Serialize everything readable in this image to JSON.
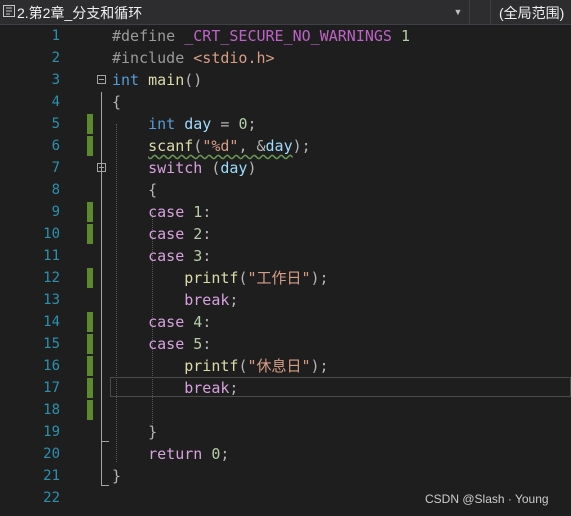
{
  "topbar": {
    "file_label": "2.第2章_分支和循环",
    "scope_label": "(全局范围)"
  },
  "line_numbers": [
    "1",
    "2",
    "3",
    "4",
    "5",
    "6",
    "7",
    "8",
    "9",
    "10",
    "11",
    "12",
    "13",
    "14",
    "15",
    "16",
    "17",
    "18",
    "19",
    "20",
    "21",
    "22"
  ],
  "code": {
    "l1_directive": "#define",
    "l1_macro": "_CRT_SECURE_NO_WARNINGS",
    "l1_value": "1",
    "l2_directive": "#include",
    "l2_header": "<stdio.h>",
    "l3_type": "int",
    "l3_name": "main",
    "l3_parens": "()",
    "l4_brace": "{",
    "l5_type": "int",
    "l5_var": "day",
    "l5_eq": " = ",
    "l5_value": "0",
    "l5_semi": ";",
    "l6_func": "scanf",
    "l6_open": "(",
    "l6_fmt": "\"%d\"",
    "l6_comma": ", ",
    "l6_amp": "&",
    "l6_var": "day",
    "l6_close": ");",
    "l7_kw": "switch",
    "l7_open": " (",
    "l7_var": "day",
    "l7_close": ")",
    "l8_brace": "{",
    "l9_kw": "case",
    "l9_value": "1",
    "l9_colon": ":",
    "l10_kw": "case",
    "l10_value": "2",
    "l10_colon": ":",
    "l11_kw": "case",
    "l11_value": "3",
    "l11_colon": ":",
    "l12_func": "printf",
    "l12_open": "(",
    "l12_str": "\"工作日\"",
    "l12_close": ");",
    "l13_kw": "break",
    "l13_semi": ";",
    "l14_kw": "case",
    "l14_value": "4",
    "l14_colon": ":",
    "l15_kw": "case",
    "l15_value": "5",
    "l15_colon": ":",
    "l16_func": "printf",
    "l16_open": "(",
    "l16_str": "\"休息日\"",
    "l16_close": ");",
    "l17_kw": "break",
    "l17_semi": ";",
    "l19_brace": "}",
    "l20_kw": "return",
    "l20_value": "0",
    "l20_semi": ";",
    "l21_brace": "}"
  },
  "watermark": "CSDN @Slash · Young",
  "colors": {
    "editor_bg": "#1e1e1e",
    "line_number": "#2b91af",
    "keyword": "#569cd6",
    "control_keyword": "#d8a0df",
    "string": "#d69d85",
    "macro": "#bd63c5",
    "function": "#dcdcaa",
    "variable": "#9cdcfe",
    "change_bar": "#5c8a2d"
  },
  "icons": [
    "solution-file-icon",
    "dropdown-arrow-icon",
    "fold-collapse-icon"
  ]
}
